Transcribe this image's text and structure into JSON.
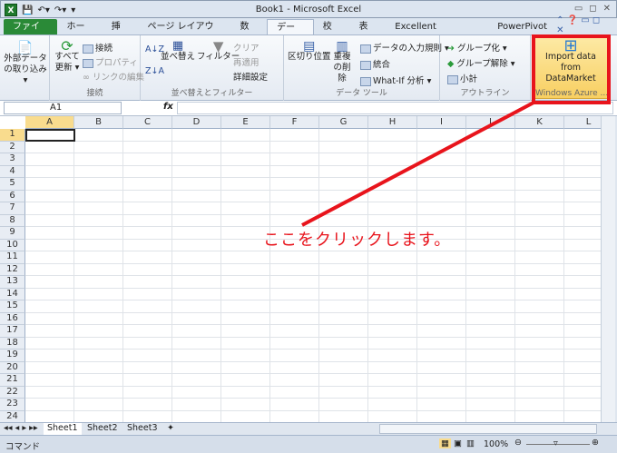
{
  "window": {
    "title": "Book1 - Microsoft Excel"
  },
  "tabs": [
    "ファイル",
    "ホーム",
    "挿入",
    "ページ レイアウト",
    "数式",
    "データ",
    "校閲",
    "表示",
    "Excellent Analytics",
    "PowerPivot"
  ],
  "ribbon": {
    "get_external": "外部データの取り込み ▾",
    "refresh_all": "すべて更新 ▾",
    "connections": "接続",
    "properties": "プロパティ",
    "edit_links": "リンクの編集",
    "group_connections": "接続",
    "sort_az": "A↓Z",
    "sort_za": "Z↓A",
    "sort": "並べ替え",
    "filter": "フィルター",
    "clear": "クリア",
    "reapply": "再適用",
    "advanced": "詳細設定",
    "group_sort": "並べ替えとフィルター",
    "text_to_columns": "区切り位置",
    "remove_dup": "重複の削除",
    "validation": "データの入力規則 ▾",
    "consolidate": "統合",
    "whatif": "What-If 分析 ▾",
    "group_tools": "データ ツール",
    "group": "グループ化 ▾",
    "ungroup": "グループ解除 ▾",
    "subtotal": "小計",
    "group_outline": "アウトライン",
    "import_data": "Import data from DataMarket",
    "group_azure": "Windows Azure ..."
  },
  "formula": {
    "namebox": "A1",
    "fx": "fx",
    "value": ""
  },
  "columns": [
    "A",
    "B",
    "C",
    "D",
    "E",
    "F",
    "G",
    "H",
    "I",
    "J",
    "K",
    "L"
  ],
  "rows": [
    "1",
    "2",
    "3",
    "4",
    "5",
    "6",
    "7",
    "8",
    "9",
    "10",
    "11",
    "12",
    "13",
    "14",
    "15",
    "16",
    "17",
    "18",
    "19",
    "20",
    "21",
    "22",
    "23",
    "24"
  ],
  "selected_cell": "A1",
  "sheets": [
    "Sheet1",
    "Sheet2",
    "Sheet3"
  ],
  "status": {
    "mode": "コマンド",
    "zoom": "100%"
  },
  "annotation": {
    "text": "ここをクリックします。",
    "color": "#e8141c"
  }
}
